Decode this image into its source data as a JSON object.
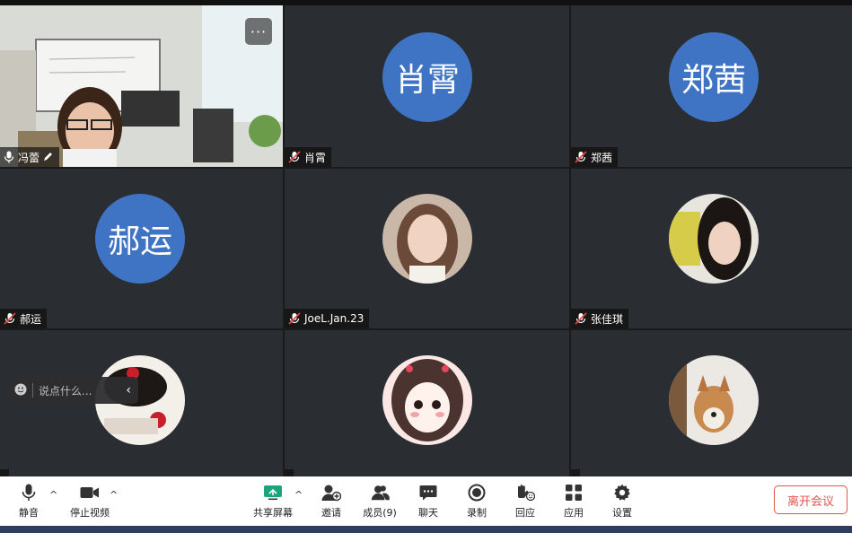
{
  "participants": [
    {
      "name": "冯蕾",
      "avatar_text": "",
      "mic": "on",
      "kind": "video"
    },
    {
      "name": "肖霄",
      "avatar_text": "肖霄",
      "mic": "muted",
      "kind": "initials"
    },
    {
      "name": "郑茜",
      "avatar_text": "郑茜",
      "mic": "muted",
      "kind": "initials"
    },
    {
      "name": "郝运",
      "avatar_text": "郝运",
      "mic": "muted",
      "kind": "initials"
    },
    {
      "name": "JoeL.Jan.23",
      "avatar_text": "",
      "mic": "muted",
      "kind": "photo"
    },
    {
      "name": "张佳琪",
      "avatar_text": "",
      "mic": "muted",
      "kind": "photo"
    },
    {
      "name": "",
      "avatar_text": "",
      "mic": "muted",
      "kind": "photo"
    },
    {
      "name": "",
      "avatar_text": "",
      "mic": "muted",
      "kind": "photo"
    },
    {
      "name": "",
      "avatar_text": "",
      "mic": "muted",
      "kind": "photo"
    }
  ],
  "chat": {
    "placeholder": "说点什么..."
  },
  "more_label": "···",
  "toolbar": {
    "mute": "静音",
    "stop_video": "停止视频",
    "share_screen": "共享屏幕",
    "invite": "邀请",
    "members": "成员(9)",
    "chat": "聊天",
    "record": "录制",
    "reactions": "回应",
    "apps": "应用",
    "settings": "设置",
    "leave": "离开会议"
  },
  "colors": {
    "avatar_blue": "#3f73c4",
    "leave_red": "#e0574f",
    "share_green": "#1aa57a"
  }
}
